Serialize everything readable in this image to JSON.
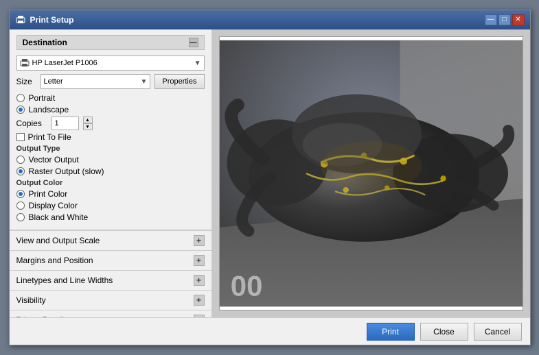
{
  "dialog": {
    "title": "Print Setup",
    "title_icon": "🖨",
    "minimize": "—",
    "maximize": "□",
    "close": "✕"
  },
  "destination": {
    "section_label": "Destination",
    "collapse_symbol": "—",
    "printer_name": "HP LaserJet P1006",
    "size_label": "Size",
    "size_value": "Letter",
    "portrait_label": "Portrait",
    "landscape_label": "Landscape",
    "copies_label": "Copies",
    "copies_value": "1",
    "print_to_file_label": "Print To File",
    "properties_label": "Properties"
  },
  "output_type": {
    "section_label": "Output Type",
    "vector_label": "Vector Output",
    "raster_label": "Raster Output (slow)"
  },
  "output_color": {
    "section_label": "Output Color",
    "print_color_label": "Print Color",
    "display_color_label": "Display Color",
    "bw_label": "Black and White"
  },
  "expandable_sections": [
    {
      "label": "View and Output Scale",
      "symbol": "+"
    },
    {
      "label": "Margins and Position",
      "symbol": "+"
    },
    {
      "label": "Linetypes and Line Widths",
      "symbol": "+"
    },
    {
      "label": "Visibility",
      "symbol": "+"
    },
    {
      "label": "Printer Details",
      "symbol": "+"
    }
  ],
  "footer": {
    "print_label": "Print",
    "close_label": "Close",
    "cancel_label": "Cancel"
  }
}
